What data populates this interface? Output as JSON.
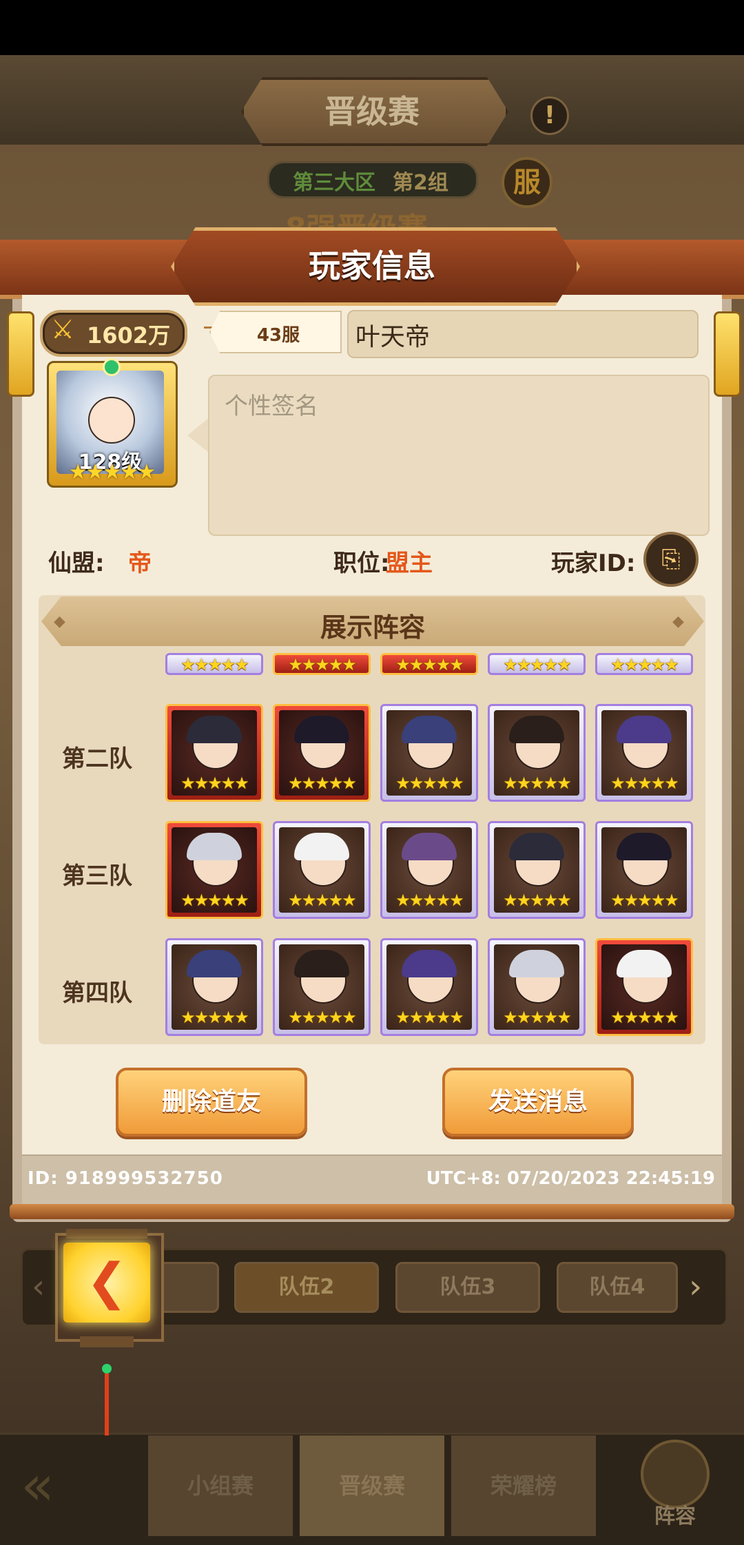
{
  "background": {
    "title": "晋级赛",
    "info_icon": "!",
    "region_a": "第三大区",
    "region_b": "第2组",
    "server_button": "服",
    "subtitle": "8强晋级赛",
    "team_tabs": [
      "队伍2",
      "队伍3",
      "队伍4"
    ],
    "bottom_tabs": [
      "小组赛",
      "晋级赛",
      "荣耀榜"
    ],
    "lineup_button": "阵容"
  },
  "dialog": {
    "title": "玩家信息",
    "power": "1602万",
    "server": "43服",
    "player_name": "叶天帝",
    "level": "128级",
    "signature_placeholder": "个性签名",
    "alliance_label": "仙盟:",
    "alliance_value": "帝",
    "role_label": "职位:",
    "role_value": "盟主",
    "player_id_label": "玩家ID:",
    "lineup_title": "展示阵容",
    "teams": [
      {
        "label": "第二队",
        "heroes": [
          "red",
          "red",
          "purple",
          "purple",
          "purple"
        ]
      },
      {
        "label": "第三队",
        "heroes": [
          "red",
          "purple",
          "purple",
          "purple",
          "purple"
        ]
      },
      {
        "label": "第四队",
        "heroes": [
          "purple",
          "purple",
          "purple",
          "purple",
          "red"
        ]
      }
    ],
    "delete_button": "删除道友",
    "message_button": "发送消息",
    "footer_id": "ID: 918999532750",
    "footer_time": "UTC+8: 07/20/2023 22:45:19"
  },
  "stars": "★★★★★",
  "colors": {
    "accent_orange": "#e4581b",
    "gold": "#ffd41e",
    "paper": "#f4ecd9"
  }
}
